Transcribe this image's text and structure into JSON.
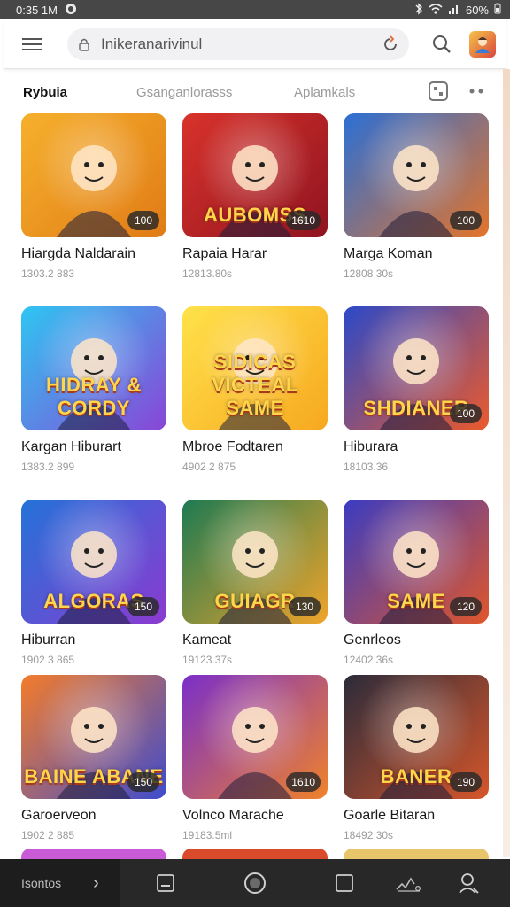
{
  "status_bar": {
    "time": "0:35 1M",
    "battery": "60%"
  },
  "browser": {
    "url": "Inikeranarivinul"
  },
  "tabs": [
    {
      "label": "Rybuia",
      "active": true
    },
    {
      "label": "Gsanganlorasss",
      "active": false
    },
    {
      "label": "Aplamkals",
      "active": false
    }
  ],
  "cards": [
    {
      "thumb_text": "",
      "badge": "100",
      "title": "Hiargda Naldarain",
      "sub": "1303.2 883",
      "bg": [
        "#f6b02c",
        "#e07b16"
      ]
    },
    {
      "thumb_text": "AUBOMSS",
      "badge": "1610",
      "title": "Rapaia Harar",
      "sub": "12813.80s",
      "bg": [
        "#d9322b",
        "#8f1420"
      ]
    },
    {
      "thumb_text": "",
      "badge": "100",
      "title": "Marga Koman",
      "sub": "12808 30s",
      "bg": [
        "#2a6fd6",
        "#e4742a"
      ]
    },
    {
      "thumb_text": "HIDRAY & CORDY",
      "badge": "",
      "title": "Kargan Hiburart",
      "sub": "1383.2 899",
      "bg": [
        "#2ec6f2",
        "#8a45d6"
      ]
    },
    {
      "thumb_text": "SIDICAS VICTEAL SAME",
      "badge": "",
      "title": "Mbroe Fodtaren",
      "sub": "4902 2 875",
      "bg": [
        "#ffe24a",
        "#f7a81f"
      ]
    },
    {
      "thumb_text": "SHDIANER",
      "badge": "100",
      "title": "Hiburara",
      "sub": "18103.36",
      "bg": [
        "#2b49c9",
        "#ec5a2b"
      ]
    },
    {
      "thumb_text": "ALGORAS",
      "badge": "150",
      "title": "Hiburran",
      "sub": "1902 3 865",
      "bg": [
        "#2472d8",
        "#8c3ad0"
      ]
    },
    {
      "thumb_text": "GUIAGR",
      "badge": "130",
      "title": "Kameat",
      "sub": "19123.37s",
      "bg": [
        "#1d7a52",
        "#f0a42a"
      ]
    },
    {
      "thumb_text": "SAME",
      "badge": "120",
      "title": "Genrleos",
      "sub": "12402 36s",
      "bg": [
        "#3a3cc2",
        "#e0562a"
      ]
    },
    {
      "thumb_text": "BAINE ABANE",
      "badge": "150",
      "title": "Garoerveon",
      "sub": "1902 2 885",
      "bg": [
        "#f47c2a",
        "#3e4ccf"
      ]
    },
    {
      "thumb_text": "",
      "badge": "1610",
      "title": "Volnco Marache",
      "sub": "19183.5ml",
      "bg": [
        "#7a2fc9",
        "#f0822a"
      ]
    },
    {
      "thumb_text": "BANER",
      "badge": "190",
      "title": "Goarle Bitaran",
      "sub": "18492 30s",
      "bg": [
        "#2b2b3a",
        "#d6562a"
      ]
    }
  ],
  "peek_colors": [
    "#c95bd6",
    "#d94b2a",
    "#e8c46a"
  ],
  "nav": {
    "left_label": "Isontos"
  }
}
